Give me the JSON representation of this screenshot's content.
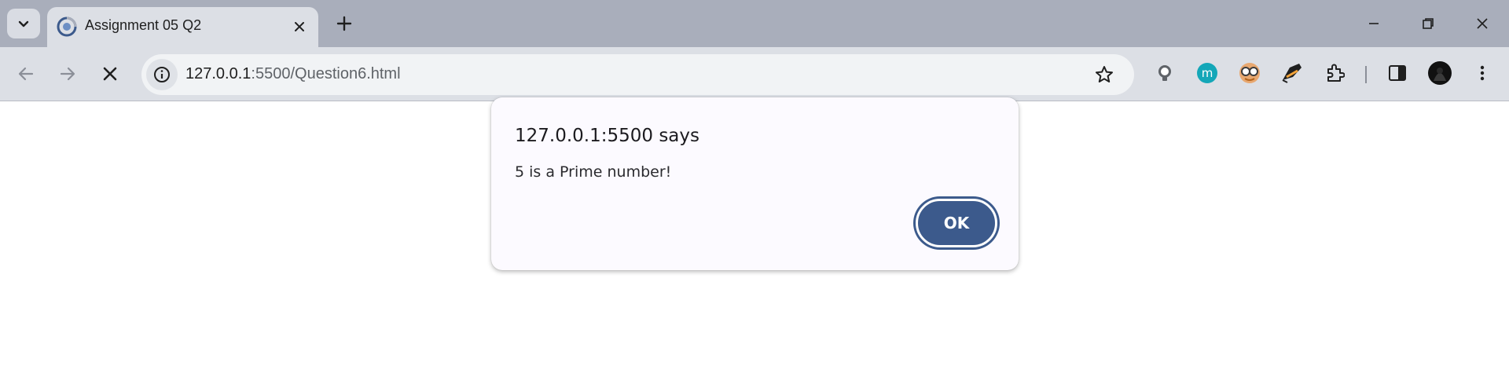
{
  "browser": {
    "tab": {
      "title": "Assignment 05 Q2"
    },
    "address": {
      "host": "127.0.0.1",
      "rest": ":5500/Question6.html"
    },
    "colors": {
      "accent": "#3c5a8c",
      "tabstrip": "#a9aebb",
      "toolbar": "#dcdfe5"
    },
    "toolbar_icons": [
      "back-icon",
      "forward-icon",
      "stop-icon",
      "site-info-icon",
      "bookmark-star-icon"
    ],
    "extension_icons": [
      "bulb-extension-icon",
      "m-extension-icon",
      "glasses-extension-icon",
      "pen-extension-icon",
      "extensions-puzzle-icon",
      "side-panel-icon",
      "profile-avatar-icon",
      "menu-icon"
    ]
  },
  "dialog": {
    "title": "127.0.0.1:5500 says",
    "message": "5 is a Prime number!",
    "ok_label": "OK"
  }
}
